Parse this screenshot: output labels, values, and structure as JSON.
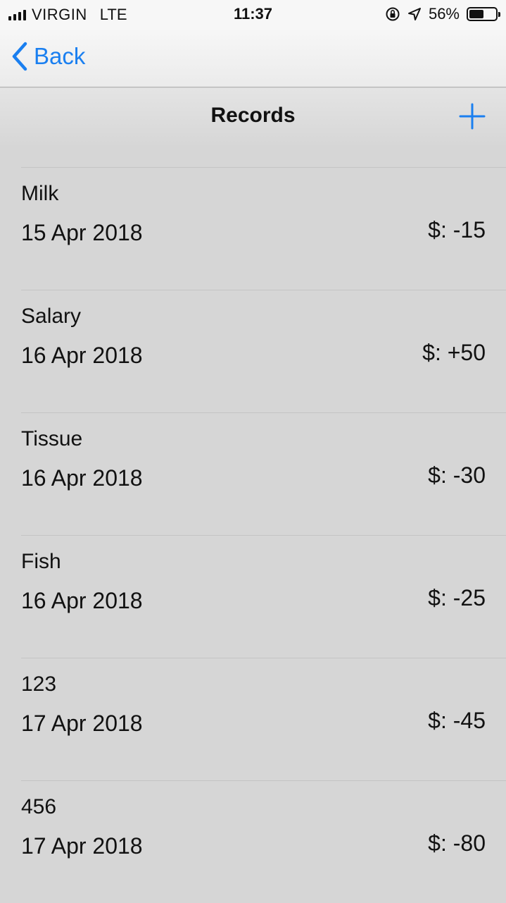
{
  "status_bar": {
    "carrier": "VIRGIN",
    "network": "LTE",
    "time": "11:37",
    "battery_percent": "56%",
    "battery_level": 0.56,
    "icons": [
      "signal-bars-icon",
      "rotation-lock-icon",
      "location-arrow-icon",
      "battery-icon"
    ]
  },
  "nav": {
    "back_label": "Back",
    "back_icon": "chevron-left-icon"
  },
  "header": {
    "title": "Records",
    "add_icon": "plus-icon"
  },
  "accent_color": "#1a7ff0",
  "records": [
    {
      "title": "Milk",
      "date": "15 Apr 2018",
      "amount": "$: -15"
    },
    {
      "title": "Salary",
      "date": "16 Apr 2018",
      "amount": "$: +50"
    },
    {
      "title": "Tissue",
      "date": "16 Apr 2018",
      "amount": "$: -30"
    },
    {
      "title": "Fish",
      "date": "16 Apr 2018",
      "amount": "$: -25"
    },
    {
      "title": "123",
      "date": "17 Apr 2018",
      "amount": "$: -45"
    },
    {
      "title": "456",
      "date": "17 Apr 2018",
      "amount": "$: -80"
    }
  ]
}
